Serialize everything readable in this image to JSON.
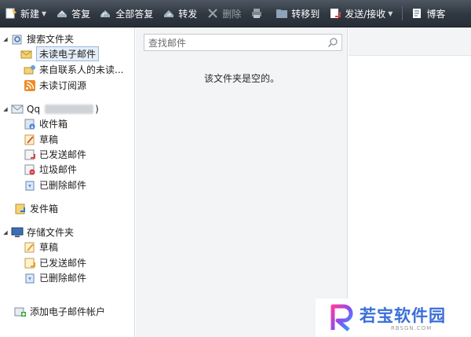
{
  "toolbar": {
    "new_label": "新建",
    "reply_label": "答复",
    "reply_all_label": "全部答复",
    "forward_label": "转发",
    "delete_label": "删除",
    "move_label": "转移到",
    "send_receive_label": "发送/接收",
    "blog_label": "博客"
  },
  "tree": {
    "search_folders": "搜索文件夹",
    "unread_mail": "未读电子邮件",
    "from_contacts_unread": "来自联系人的未读...",
    "unread_feeds": "未读订阅源",
    "account_prefix": "Qq",
    "account_suffix": ")",
    "inbox": "收件箱",
    "drafts": "草稿",
    "sent": "已发送邮件",
    "junk": "垃圾邮件",
    "deleted": "已删除邮件",
    "outbox": "发件箱",
    "storage_folders": "存储文件夹",
    "storage_drafts": "草稿",
    "storage_sent": "已发送邮件",
    "storage_deleted": "已删除邮件",
    "add_account": "添加电子邮件帐户"
  },
  "search": {
    "placeholder": "查找邮件"
  },
  "message_list": {
    "empty_text": "该文件夹是空的。"
  },
  "watermark": {
    "text": "若宝软件园",
    "sub": "RBSGN.COM"
  },
  "colors": {
    "toolbar_bg": "#2f3740",
    "selection_bg": "#e4eef8",
    "watermark_blue": "#3a6fd8"
  }
}
